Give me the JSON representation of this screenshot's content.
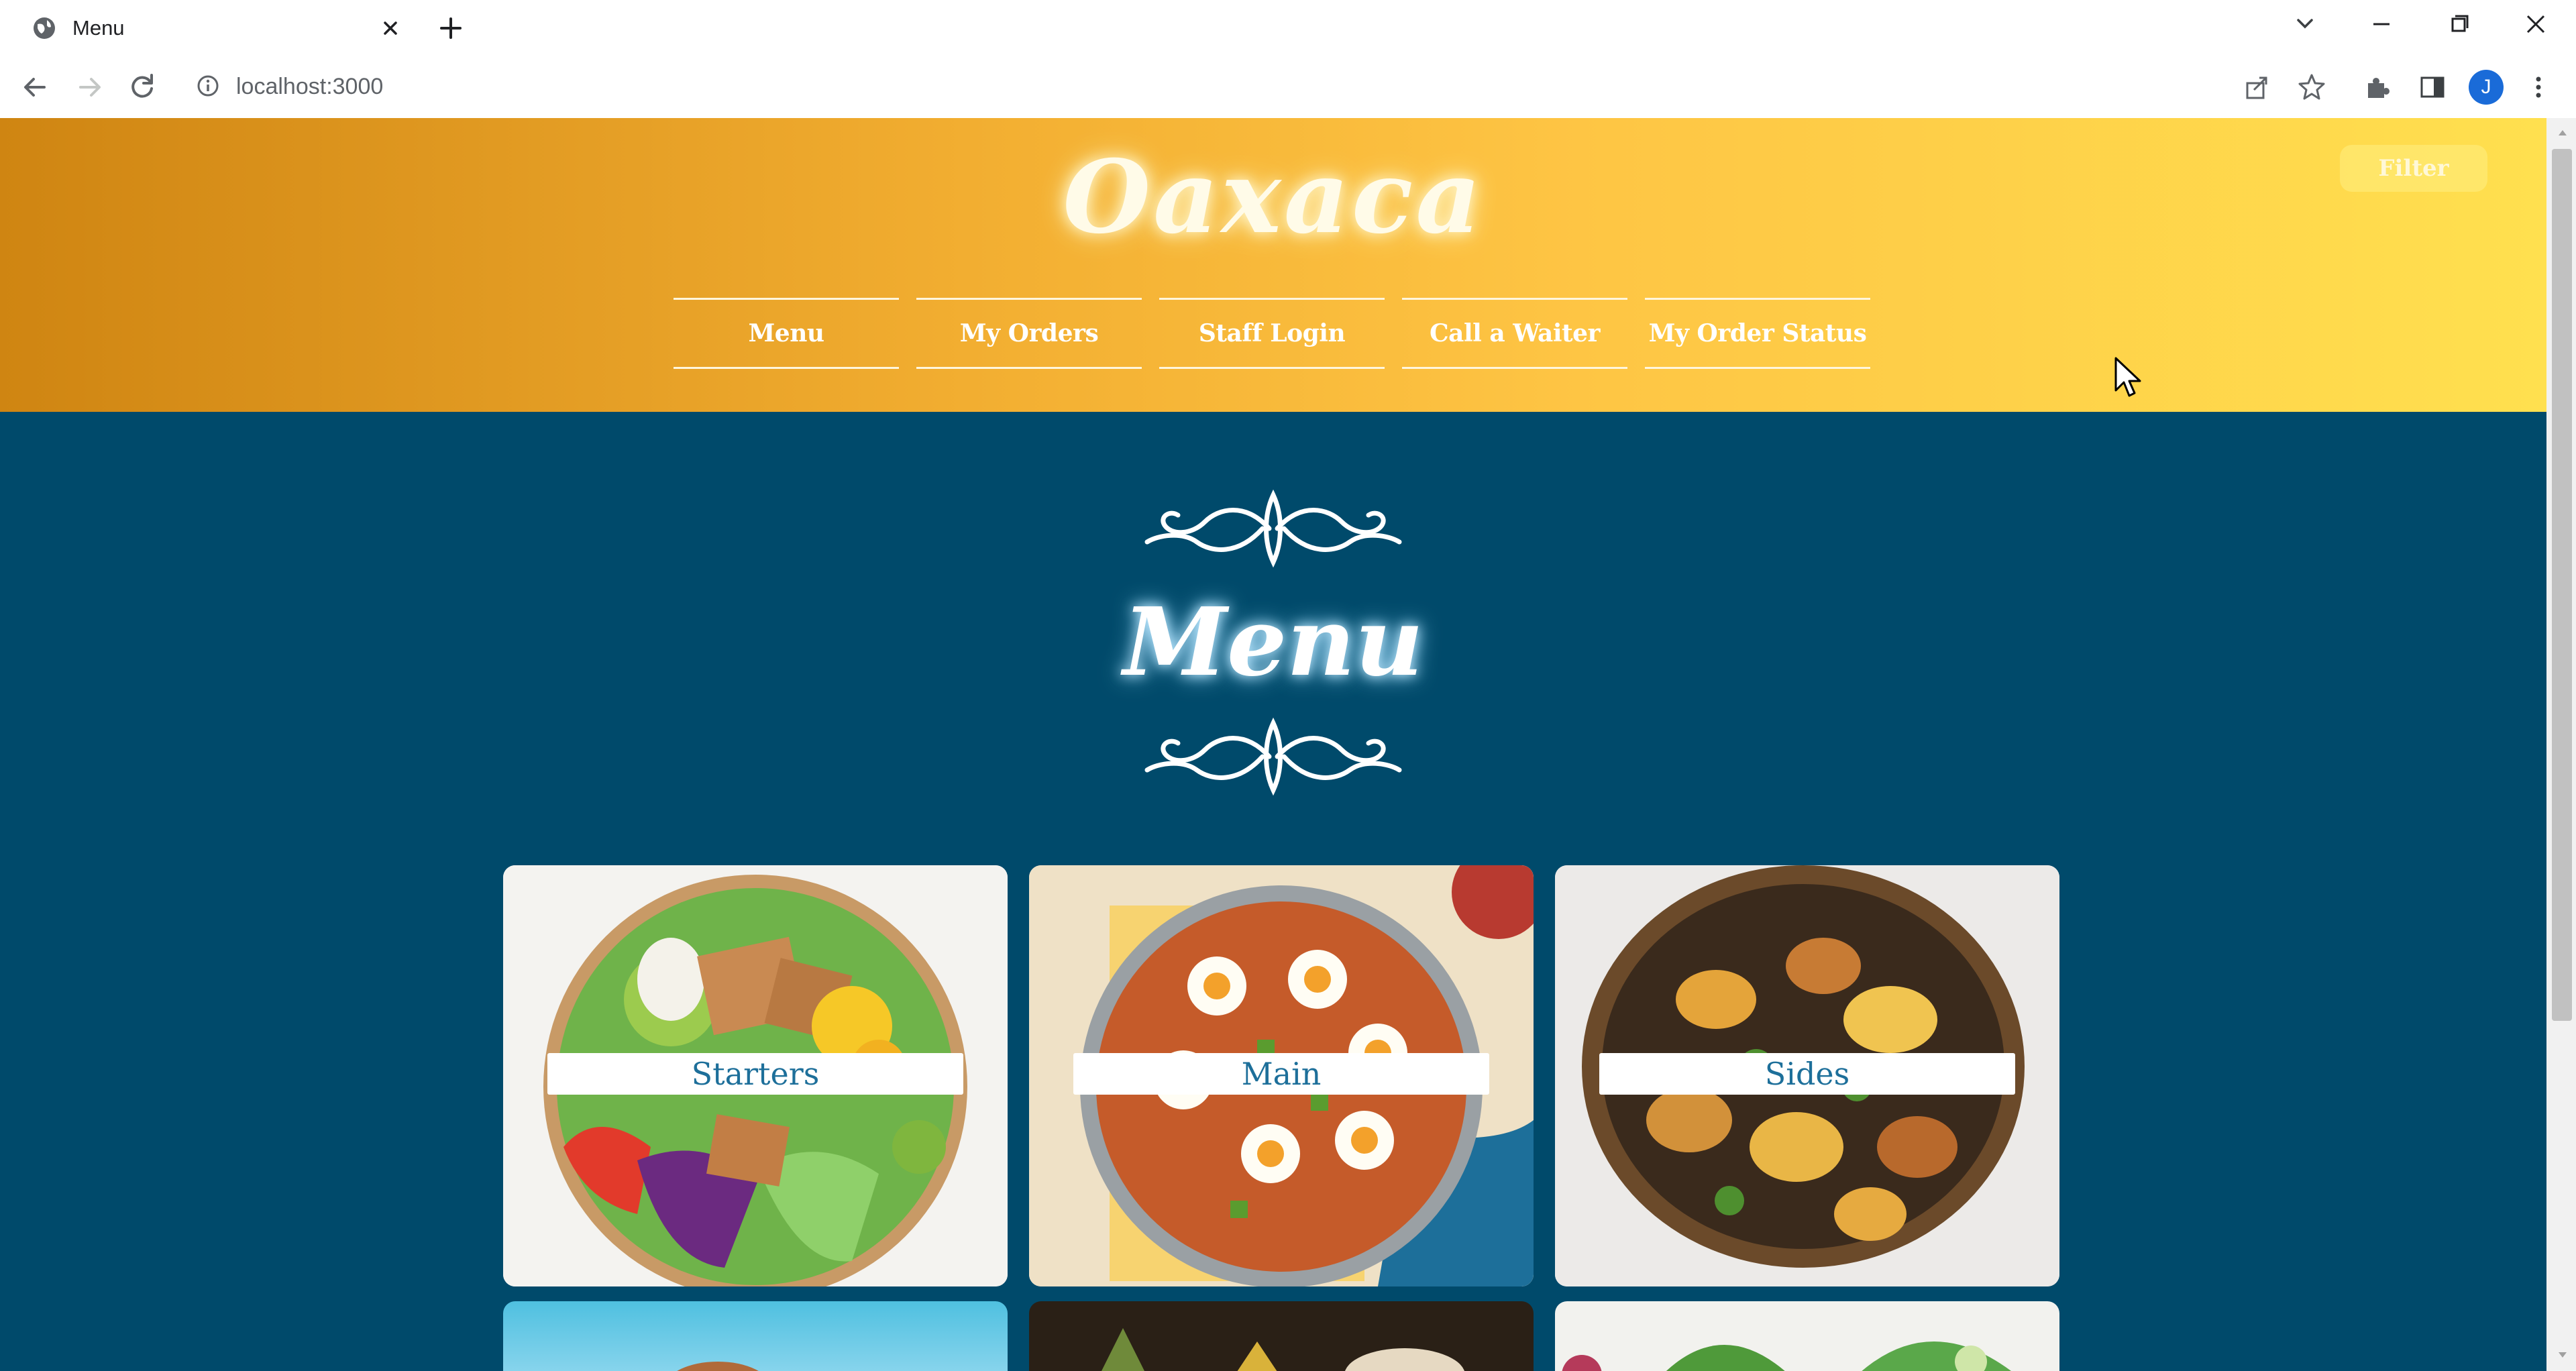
{
  "browser": {
    "tab_title": "Menu",
    "url": "localhost:3000",
    "avatar_initial": "J"
  },
  "header": {
    "brand": "Oaxaca",
    "filter_label": "Filter",
    "nav": [
      {
        "label": "Menu"
      },
      {
        "label": "My Orders"
      },
      {
        "label": "Staff Login"
      },
      {
        "label": "Call a Waiter"
      },
      {
        "label": "My Order Status"
      }
    ]
  },
  "main": {
    "title": "Menu",
    "categories": [
      {
        "label": "Starters"
      },
      {
        "label": "Main"
      },
      {
        "label": "Sides"
      }
    ]
  },
  "colors": {
    "page_background": "#004a6b",
    "header_gradient_start": "#cf8512",
    "header_gradient_end": "#ffe04f",
    "label_text": "#1d6f9a"
  }
}
